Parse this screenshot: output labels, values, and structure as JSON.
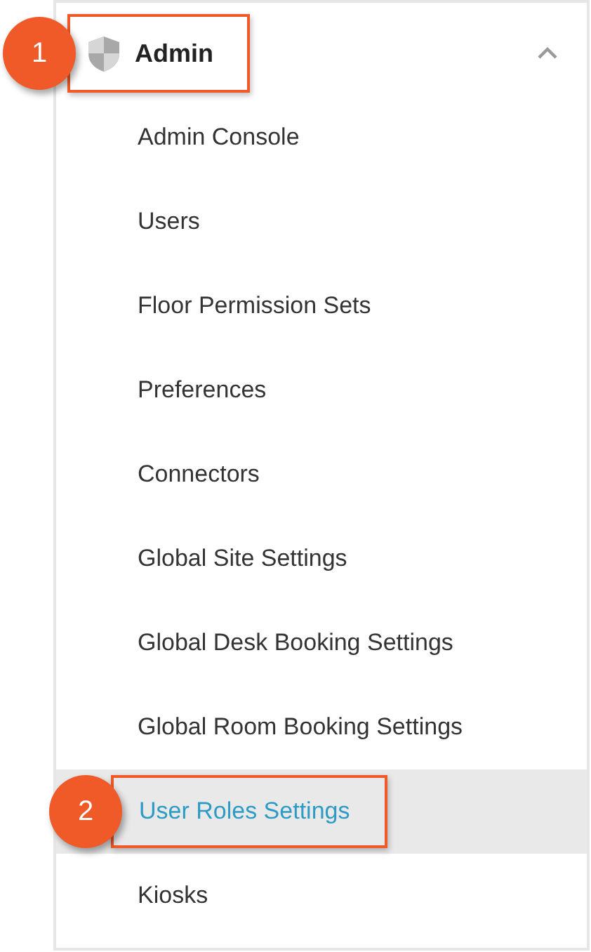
{
  "section": {
    "title": "Admin",
    "expanded": true,
    "highlighted": true,
    "callout": "1"
  },
  "items": [
    {
      "label": "Admin Console",
      "selected": false
    },
    {
      "label": "Users",
      "selected": false
    },
    {
      "label": "Floor Permission Sets",
      "selected": false
    },
    {
      "label": "Preferences",
      "selected": false
    },
    {
      "label": "Connectors",
      "selected": false
    },
    {
      "label": "Global Site Settings",
      "selected": false
    },
    {
      "label": "Global Desk Booking Settings",
      "selected": false
    },
    {
      "label": "Global Room Booking Settings",
      "selected": false
    },
    {
      "label": "User Roles Settings",
      "selected": true,
      "callout": "2"
    },
    {
      "label": "Kiosks",
      "selected": false
    }
  ]
}
